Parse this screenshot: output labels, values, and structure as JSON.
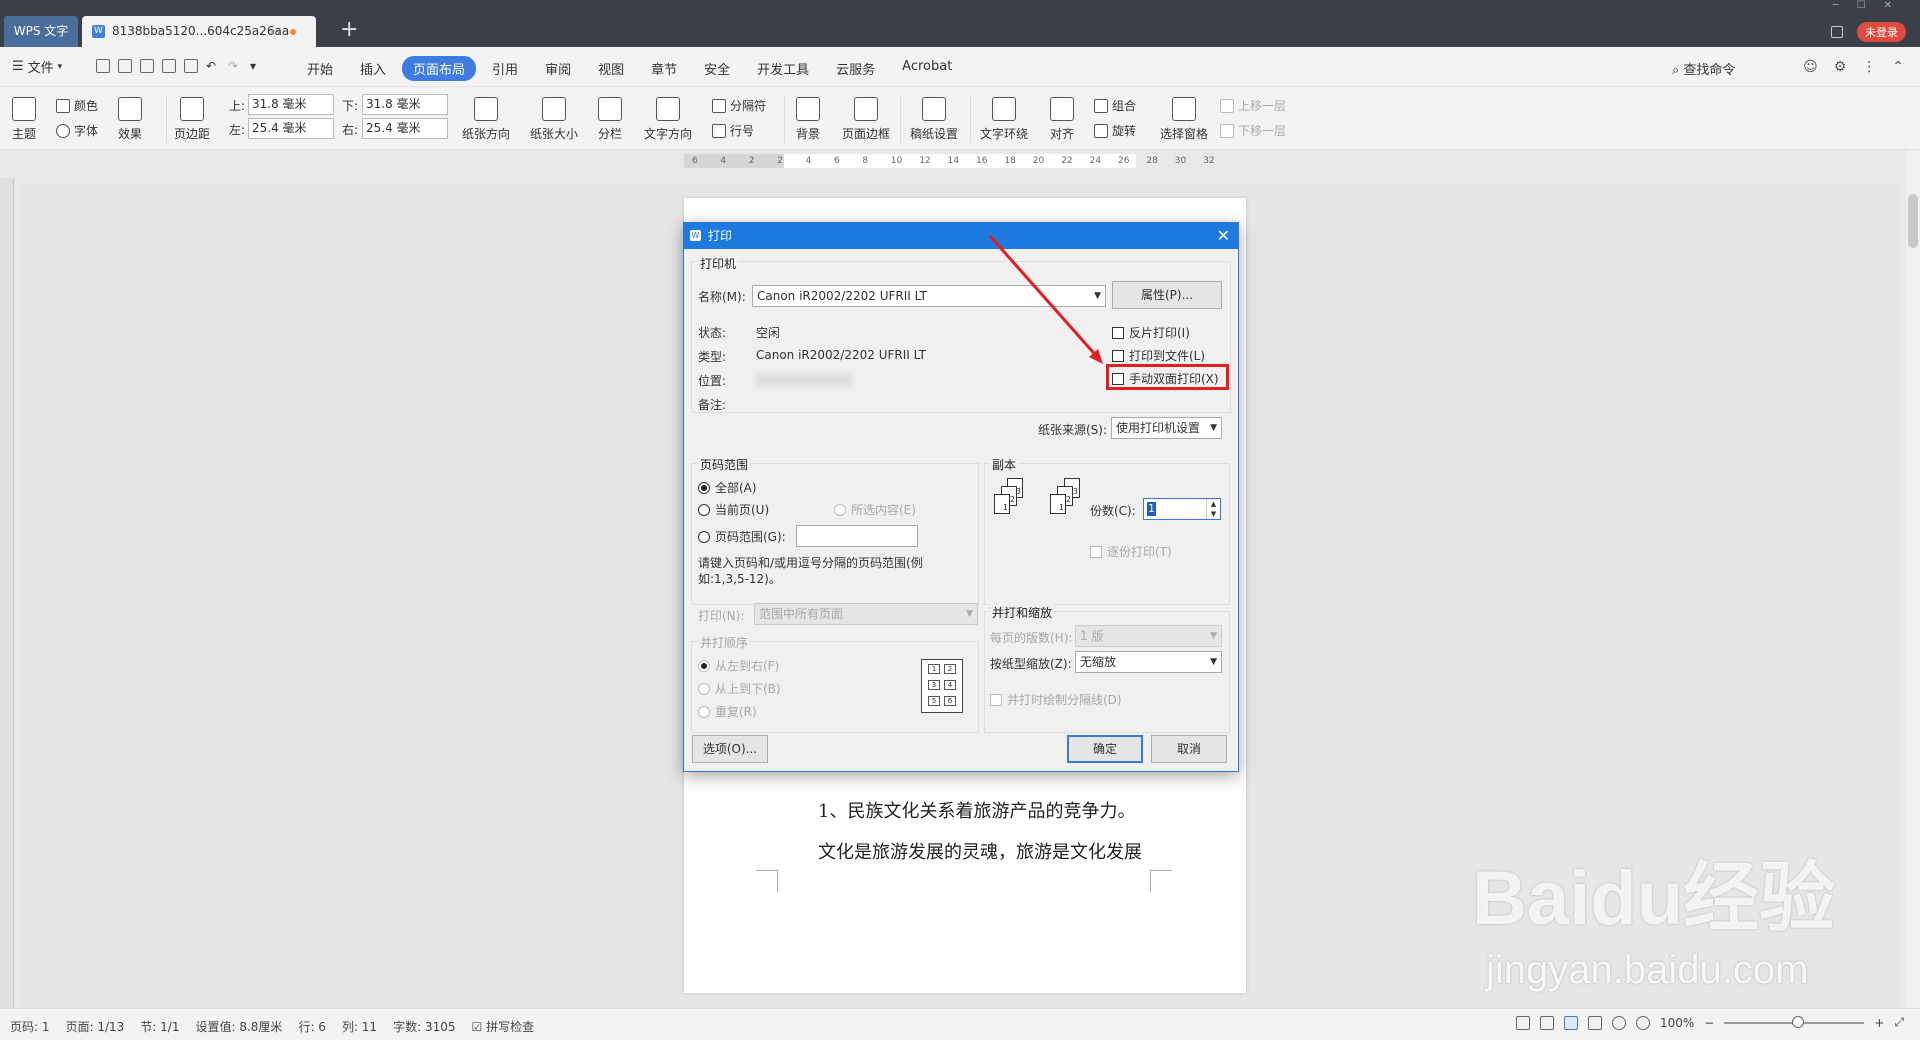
{
  "titlebar": {
    "app_tab": "WPS 文字",
    "doc_tab": "8138bba5120...604c25a26aa",
    "login": "未登录"
  },
  "menubar": {
    "file": "文件",
    "tabs": [
      "开始",
      "插入",
      "页面布局",
      "引用",
      "审阅",
      "视图",
      "章节",
      "安全",
      "开发工具",
      "云服务",
      "Acrobat"
    ],
    "active_tab": "页面布局",
    "search": "查找命令"
  },
  "ribbon": {
    "theme": "主题",
    "color": "颜色",
    "font": "字体",
    "effect": "效果",
    "margins": "页边距",
    "top_label": "上:",
    "top_value": "31.8 毫米",
    "bottom_label": "下:",
    "bottom_value": "31.8 毫米",
    "left_label": "左:",
    "left_value": "25.4 毫米",
    "right_label": "右:",
    "right_value": "25.4 毫米",
    "orientation": "纸张方向",
    "size": "纸张大小",
    "columns": "分栏",
    "text_direction": "文字方向",
    "breaks": "分隔符",
    "line_numbers": "行号",
    "background": "背景",
    "page_border": "页面边框",
    "draft_settings": "稿纸设置",
    "wrap": "文字环绕",
    "align": "对齐",
    "group": "组合",
    "rotate": "旋转",
    "selection_pane": "选择窗格",
    "bring_forward": "上移一层",
    "send_backward": "下移一层"
  },
  "ruler": {
    "ticks": [
      "6",
      "4",
      "2",
      "2",
      "4",
      "6",
      "8",
      "10",
      "12",
      "14",
      "16",
      "18",
      "20",
      "22",
      "24",
      "26",
      "28",
      "30",
      "32"
    ]
  },
  "document": {
    "line1": "1、民族文化关系着旅游产品的竞争力。",
    "line2": "文化是旅游发展的灵魂，旅游是文化发展"
  },
  "dialog": {
    "title": "打印",
    "printer_group": "打印机",
    "name_label": "名称(M):",
    "printer_name": "Canon iR2002/2202 UFRII LT",
    "properties_btn": "属性(P)...",
    "status_label": "状态:",
    "status_value": "空闲",
    "type_label": "类型:",
    "type_value": "Canon iR2002/2202 UFRII LT",
    "location_label": "位置:",
    "comment_label": "备注:",
    "reverse_print": "反片打印(I)",
    "print_to_file": "打印到文件(L)",
    "manual_duplex": "手动双面打印(X)",
    "paper_source_label": "纸张来源(S):",
    "paper_source_value": "使用打印机设置",
    "page_range_group": "页码范围",
    "all": "全部(A)",
    "current_page": "当前页(U)",
    "selection": "所选内容(E)",
    "page_range": "页码范围(G):",
    "range_hint": "请键入页码和/或用逗号分隔的页码范围(例如:1,3,5-12)。",
    "print_label": "打印(N):",
    "print_value": "范围中所有页面",
    "collate_order_group": "并打顺序",
    "left_to_right": "从左到右(F)",
    "top_to_bottom": "从上到下(B)",
    "repeat": "重复(R)",
    "copies_group": "副本",
    "copies_label": "份数(C):",
    "copies_value": "1",
    "collate": "逐份打印(T)",
    "zoom_group": "并打和缩放",
    "pages_per_sheet_label": "每页的版数(H):",
    "pages_per_sheet_value": "1 版",
    "scale_label": "按纸型缩放(Z):",
    "scale_value": "无缩放",
    "draw_borders": "并打时绘制分隔线(D)",
    "options_btn": "选项(O)...",
    "ok_btn": "确定",
    "cancel_btn": "取消"
  },
  "statusbar": {
    "page_code": "页码: 1",
    "page": "页面: 1/13",
    "section": "节: 1/1",
    "setting": "设置值: 8.8厘米",
    "row": "行: 6",
    "col": "列: 11",
    "word_count": "字数: 3105",
    "spell_check": "拼写检查",
    "zoom": "100%"
  },
  "watermark": {
    "brand": "Baidu经验",
    "url": "jingyan.baidu.com"
  },
  "colors": {
    "accent": "#3e7ce0",
    "highlight": "#e02020",
    "titlebar": "#3c4048"
  }
}
